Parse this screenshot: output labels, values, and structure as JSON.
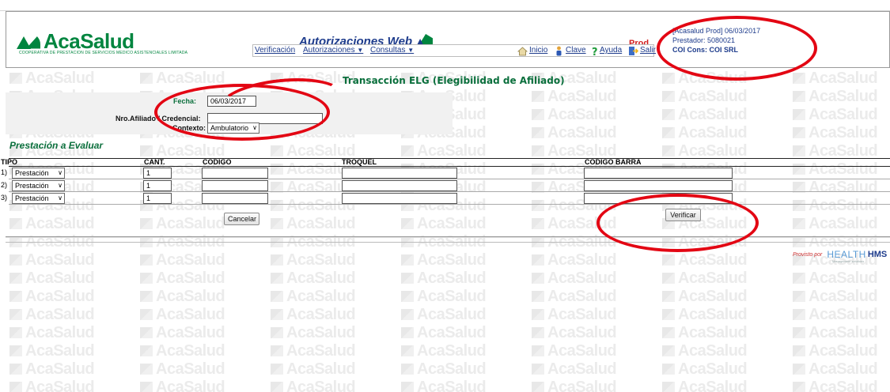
{
  "header": {
    "logo_text": "AcaSalud",
    "logo_sub": "COOPERATIVA DE PRESTACION DE SERVICIOS MEDICO ASISTENCIALES LIMITADA",
    "app_title": "Autorizaciones Web",
    "env": "Prod",
    "user_line1": "[Acasalud Prod] 06/03/2017",
    "user_line2": "Prestador: 5080021",
    "user_line3": "COI Cons: COI SRL"
  },
  "menu": {
    "items": [
      {
        "label": "Verificación"
      },
      {
        "label": "Autorizaciones",
        "caret": "▼"
      },
      {
        "label": "Consultas",
        "caret": "▼"
      }
    ],
    "actions": [
      {
        "label": "Inicio",
        "icon": "home-icon"
      },
      {
        "label": "Clave",
        "icon": "key-person-icon"
      },
      {
        "label": "Ayuda",
        "icon": "question-icon"
      },
      {
        "label": "Salir",
        "icon": "exit-icon"
      }
    ]
  },
  "watermark_text": "AcaSalud",
  "transaction": {
    "title": "Transacción ELG (Elegibilidad de Afiliado)",
    "fecha_label": "Fecha:",
    "fecha_value": "06/03/2017",
    "afiliado_label": "Nro.Afiliado / Credencial:",
    "afiliado_value": "",
    "contexto_label": "Contexto:",
    "contexto_value": "Ambulatorio"
  },
  "prestacion": {
    "section_title": "Prestación a Evaluar",
    "columns": [
      "TIPO",
      "CANT.",
      "CODIGO",
      "TROQUEL",
      "CODIGO BARRA"
    ],
    "rows": [
      {
        "index": "1)",
        "tipo": "Prestación",
        "cant": "1",
        "codigo": "",
        "troquel": "",
        "codigo_barra": ""
      },
      {
        "index": "2)",
        "tipo": "Prestación",
        "cant": "1",
        "codigo": "",
        "troquel": "",
        "codigo_barra": ""
      },
      {
        "index": "3)",
        "tipo": "Prestación",
        "cant": "1",
        "codigo": "",
        "troquel": "",
        "codigo_barra": ""
      }
    ],
    "cancel_label": "Cancelar",
    "verify_label": "Verificar"
  },
  "footer": {
    "provisto_por": "Provisto por",
    "brand_health": "HEALTH",
    "brand_hms": "HMS",
    "brand_sub": "Management solutions"
  },
  "colors": {
    "brand_green": "#00853f",
    "title_blue": "#1e3c8c",
    "env_red": "#d21e1e",
    "annotation_red": "#e30613"
  }
}
